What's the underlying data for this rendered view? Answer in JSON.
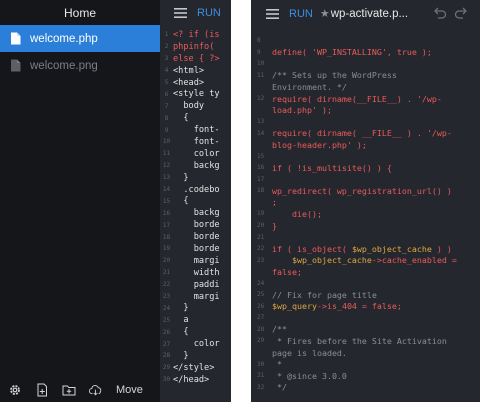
{
  "left": {
    "drawer": {
      "title": "Home",
      "files": [
        {
          "name": "welcome.php",
          "selected": true
        },
        {
          "name": "welcome.png",
          "selected": false
        }
      ],
      "footer": {
        "move_label": "Move"
      }
    },
    "toolbar": {
      "run_label": "RUN"
    },
    "code": [
      {
        "n": "1",
        "t": "<? if (is",
        "red": true
      },
      {
        "n": "2",
        "t": "phpinfo(",
        "red": true
      },
      {
        "n": "3",
        "t": "else { ?>",
        "red": true
      },
      {
        "n": "4",
        "t": "<html>",
        "red": false
      },
      {
        "n": "5",
        "t": "<head>",
        "red": false
      },
      {
        "n": "6",
        "t": "<style ty",
        "red": false
      },
      {
        "n": "7",
        "t": "  body",
        "red": false
      },
      {
        "n": "8",
        "t": "  {",
        "red": false
      },
      {
        "n": "9",
        "t": "    font-",
        "red": false
      },
      {
        "n": "10",
        "t": "    font-",
        "red": false
      },
      {
        "n": "11",
        "t": "    color",
        "red": false
      },
      {
        "n": "12",
        "t": "    backg",
        "red": false
      },
      {
        "n": "13",
        "t": "  }",
        "red": false
      },
      {
        "n": "14",
        "t": "  .codebo",
        "red": false
      },
      {
        "n": "15",
        "t": "  {",
        "red": false
      },
      {
        "n": "16",
        "t": "    backg",
        "red": false
      },
      {
        "n": "17",
        "t": "    borde",
        "red": false
      },
      {
        "n": "18",
        "t": "    borde",
        "red": false
      },
      {
        "n": "19",
        "t": "    borde",
        "red": false
      },
      {
        "n": "20",
        "t": "    margi",
        "red": false
      },
      {
        "n": "21",
        "t": "    width",
        "red": false
      },
      {
        "n": "22",
        "t": "    paddi",
        "red": false
      },
      {
        "n": "23",
        "t": "    margi",
        "red": false
      },
      {
        "n": "24",
        "t": "  }",
        "red": false
      },
      {
        "n": "25",
        "t": "  a",
        "red": false
      },
      {
        "n": "26",
        "t": "  {",
        "red": false
      },
      {
        "n": "27",
        "t": "    color",
        "red": false
      },
      {
        "n": "28",
        "t": "  }",
        "red": false
      },
      {
        "n": "29",
        "t": "</style>",
        "red": false
      },
      {
        "n": "30",
        "t": "</head>",
        "red": false
      }
    ]
  },
  "right": {
    "toolbar": {
      "run_label": "RUN",
      "star": "★",
      "doc_title": "wp-activate.p..."
    },
    "code": [
      {
        "n": "8",
        "segs": []
      },
      {
        "n": "9",
        "segs": [
          [
            "def",
            "define( "
          ],
          [
            "str",
            "'WP_INSTALLING'"
          ],
          [
            "def",
            ", true );"
          ]
        ]
      },
      {
        "n": "10",
        "segs": []
      },
      {
        "n": "11",
        "segs": [
          [
            "com",
            "/** Sets up the WordPress"
          ]
        ]
      },
      {
        "n": "",
        "segs": [
          [
            "com",
            "Environment. */"
          ]
        ]
      },
      {
        "n": "12",
        "segs": [
          [
            "def",
            "require( dirname(__FILE__) . "
          ],
          [
            "str",
            "'/wp-"
          ]
        ]
      },
      {
        "n": "",
        "segs": [
          [
            "str",
            "load.php'"
          ],
          [
            "def",
            " );"
          ]
        ]
      },
      {
        "n": "13",
        "segs": []
      },
      {
        "n": "14",
        "segs": [
          [
            "def",
            "require( dirname( __FILE__ ) . "
          ],
          [
            "str",
            "'/wp-"
          ]
        ]
      },
      {
        "n": "",
        "segs": [
          [
            "str",
            "blog-header.php'"
          ],
          [
            "def",
            " );"
          ]
        ]
      },
      {
        "n": "15",
        "segs": []
      },
      {
        "n": "16",
        "segs": [
          [
            "def",
            "if ( !is_multisite() ) {"
          ]
        ]
      },
      {
        "n": "17",
        "segs": []
      },
      {
        "n": "18",
        "segs": [
          [
            "def",
            "wp_redirect( wp_registration_url() )"
          ]
        ]
      },
      {
        "n": "",
        "segs": [
          [
            "def",
            ";"
          ]
        ]
      },
      {
        "n": "19",
        "segs": [
          [
            "def",
            "    die();"
          ]
        ]
      },
      {
        "n": "20",
        "segs": [
          [
            "def",
            "}"
          ]
        ]
      },
      {
        "n": "21",
        "segs": []
      },
      {
        "n": "22",
        "segs": [
          [
            "def",
            "if ( is_object( "
          ],
          [
            "var",
            "$wp_object_cache"
          ],
          [
            "def",
            " ) )"
          ]
        ]
      },
      {
        "n": "23",
        "segs": [
          [
            "var",
            "    $wp_object_cache"
          ],
          [
            "def",
            "->cache_enabled ="
          ]
        ]
      },
      {
        "n": "",
        "segs": [
          [
            "def",
            "false;"
          ]
        ]
      },
      {
        "n": "24",
        "segs": []
      },
      {
        "n": "25",
        "segs": [
          [
            "com",
            "// Fix for page title"
          ]
        ]
      },
      {
        "n": "26",
        "segs": [
          [
            "var",
            "$wp_query"
          ],
          [
            "def",
            "->is_404 = false;"
          ]
        ]
      },
      {
        "n": "27",
        "segs": []
      },
      {
        "n": "28",
        "segs": [
          [
            "com",
            "/**"
          ]
        ]
      },
      {
        "n": "29",
        "segs": [
          [
            "com",
            " * Fires before the Site Activation"
          ]
        ]
      },
      {
        "n": "",
        "segs": [
          [
            "com",
            "page is loaded."
          ]
        ]
      },
      {
        "n": "30",
        "segs": [
          [
            "com",
            " *"
          ]
        ]
      },
      {
        "n": "31",
        "segs": [
          [
            "com",
            " * @since 3.0.0"
          ]
        ]
      },
      {
        "n": "32",
        "segs": [
          [
            "com",
            " */"
          ]
        ]
      }
    ]
  },
  "colors": {
    "accent": "#2b7fd9",
    "run": "#3d8fe0",
    "code_text": "#e3e3e3",
    "code_string": "#ec5b5b",
    "code_comment": "#8a8f96",
    "code_variable": "#e0a742"
  },
  "icons": {
    "drawer_footer": [
      "gear-icon",
      "new-file-icon",
      "new-folder-icon",
      "cloud-download-icon"
    ],
    "toolbar": [
      "hamburger-menu-icon",
      "undo-icon",
      "redo-icon"
    ]
  }
}
